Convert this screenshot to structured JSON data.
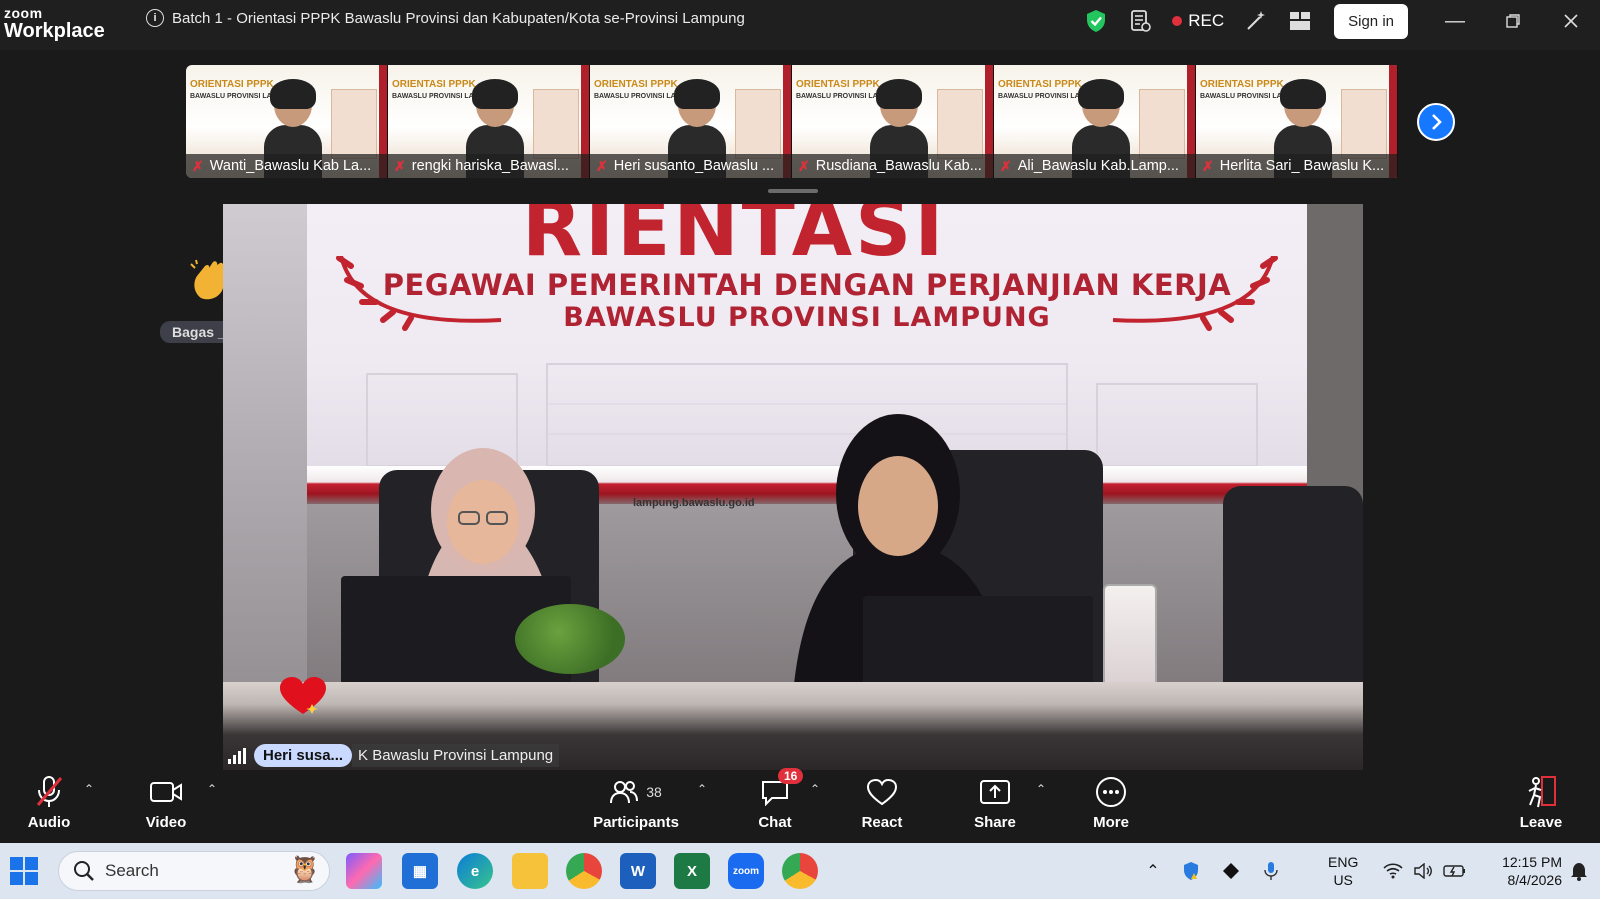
{
  "app": {
    "brand_top": "zoom",
    "brand_bottom": "Workplace",
    "meeting_title": "Batch 1 - Orientasi PPPK Bawaslu Provinsi dan Kabupaten/Kota se-Provinsi Lampung",
    "rec_label": "REC",
    "sign_in_label": "Sign in",
    "accent_color": "#1677ff",
    "rec_color": "#e0303c"
  },
  "thumbnails": [
    {
      "name": "Wanti_Bawaslu Kab La...",
      "banner": "ORIENTASI PPPK",
      "sub": "BAWASLU PROVINSI LAMPUNG"
    },
    {
      "name": "rengki hariska_Bawasl...",
      "banner": "ORIENTASI PPPK",
      "sub": "BAWASLU PROVINSI LAMPUNG"
    },
    {
      "name": "Heri susanto_Bawaslu ...",
      "banner": "ORIENTASI PPPK",
      "sub": "BAWASLU PROVINSI LAMPUNG"
    },
    {
      "name": "Rusdiana_Bawaslu Kab...",
      "banner": "ORIENTASI PPPK",
      "sub": "BAWASLU PROVINSI LAMPUNG"
    },
    {
      "name": "Ali_Bawaslu Kab.Lamp...",
      "banner": "ORIENTASI PPPK",
      "sub": "BAWASLU PROVINSI LAMPUNG"
    },
    {
      "name": "Herlita Sari_ Bawaslu K...",
      "banner": "ORIENTASI PPPK",
      "sub": "BAWASLU PROVINSI LAMPUNG"
    }
  ],
  "raised_hand": {
    "name": "Bagas _B..."
  },
  "main_video": {
    "screen_big": "RIENTASI",
    "screen_line1": "PEGAWAI PEMERINTAH DENGAN PERJANJIAN KERJA",
    "screen_line2": "BAWASLU PROVINSI LAMPUNG",
    "website": "lampung.bawaslu.go.id",
    "speaker_pill": "Heri susa...",
    "speaker_rest": "K Bawaslu Provinsi Lampung"
  },
  "controls": {
    "audio": "Audio",
    "video": "Video",
    "participants": "Participants",
    "participants_count": "38",
    "chat": "Chat",
    "chat_badge": "16",
    "react": "React",
    "share": "Share",
    "more": "More",
    "leave": "Leave"
  },
  "taskbar": {
    "search_placeholder": "Search",
    "lang_top": "ENG",
    "lang_bottom": "US",
    "time": "12:15 PM",
    "date": "8/4/2026"
  }
}
